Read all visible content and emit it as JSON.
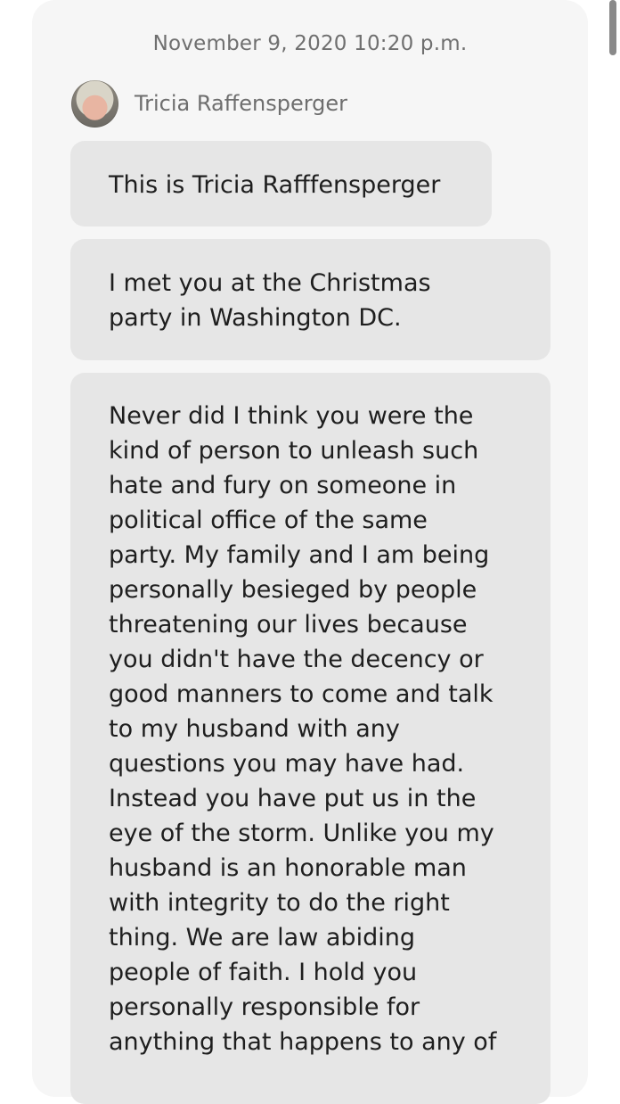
{
  "conversation": {
    "timestamp": "November 9, 2020 10:20 p.m.",
    "sender": {
      "name": "Tricia Raffensperger",
      "avatar_icon": "person-photo-avatar"
    },
    "messages": [
      {
        "lines": [
          "This is Tricia Rafffensperger"
        ]
      },
      {
        "lines": [
          "I met you at the Christmas",
          "party in Washington DC."
        ]
      },
      {
        "lines": [
          "Never did I think you were the",
          "kind of person to unleash such",
          "hate and fury on someone in",
          "political office of the same",
          "party. My family and I am being",
          "personally besieged by people",
          "threatening our lives because",
          "you didn't have the decency or",
          "good manners to come and talk",
          "to my husband with any",
          "questions you may have had.",
          "Instead you have put us in the",
          "eye of the storm. Unlike you my",
          "husband is an honorable man",
          "with integrity to do the right",
          "thing. We are law abiding",
          "people of faith. I hold you",
          "personally responsible for",
          "anything that happens to any of"
        ]
      }
    ]
  },
  "colors": {
    "panel": "#f6f6f6",
    "bubble": "#e6e6e6",
    "text": "#1e1e1e",
    "meta_text": "#6f6f6f"
  }
}
